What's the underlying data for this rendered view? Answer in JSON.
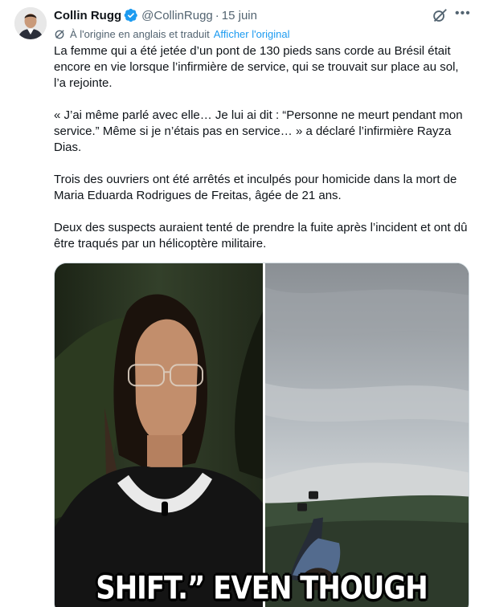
{
  "author": {
    "name": "Collin Rugg",
    "handle": "@CollinRugg",
    "separator": "·",
    "date": "15 juin"
  },
  "translation": {
    "note": "À l'origine en anglais et traduit",
    "show_original_label": "Afficher l'original"
  },
  "paragraphs": [
    "La femme qui a été jetée d’un pont de 130 pieds sans corde au Brésil était encore en vie lorsque l’infirmière de service, qui se trouvait sur place au sol, l’a rejointe.",
    "« J’ai même parlé avec elle… Je lui ai dit : “Personne ne meurt pendant mon service.” Même si je n’étais pas en service… » a déclaré l’infirmière Rayza Dias.",
    "Trois des ouvriers ont été arrêtés et inculpés pour homicide dans la mort de Maria Eduarda Rodrigues de Freitas, âgée de 21 ans.",
    "Deux des suspects auraient tenté de prendre la fuite après l’incident et ont dû être traqués par un hélicoptère militaire."
  ],
  "media": {
    "caption": "SHIFT.” EVEN THOUGH"
  },
  "icons": {
    "verified": "verified-badge-icon",
    "grok": "grok-icon",
    "more": "more-icon",
    "translate": "translate-icon"
  },
  "colors": {
    "link": "#1d9bf0",
    "secondary_text": "#536471",
    "primary_text": "#0f1419"
  }
}
